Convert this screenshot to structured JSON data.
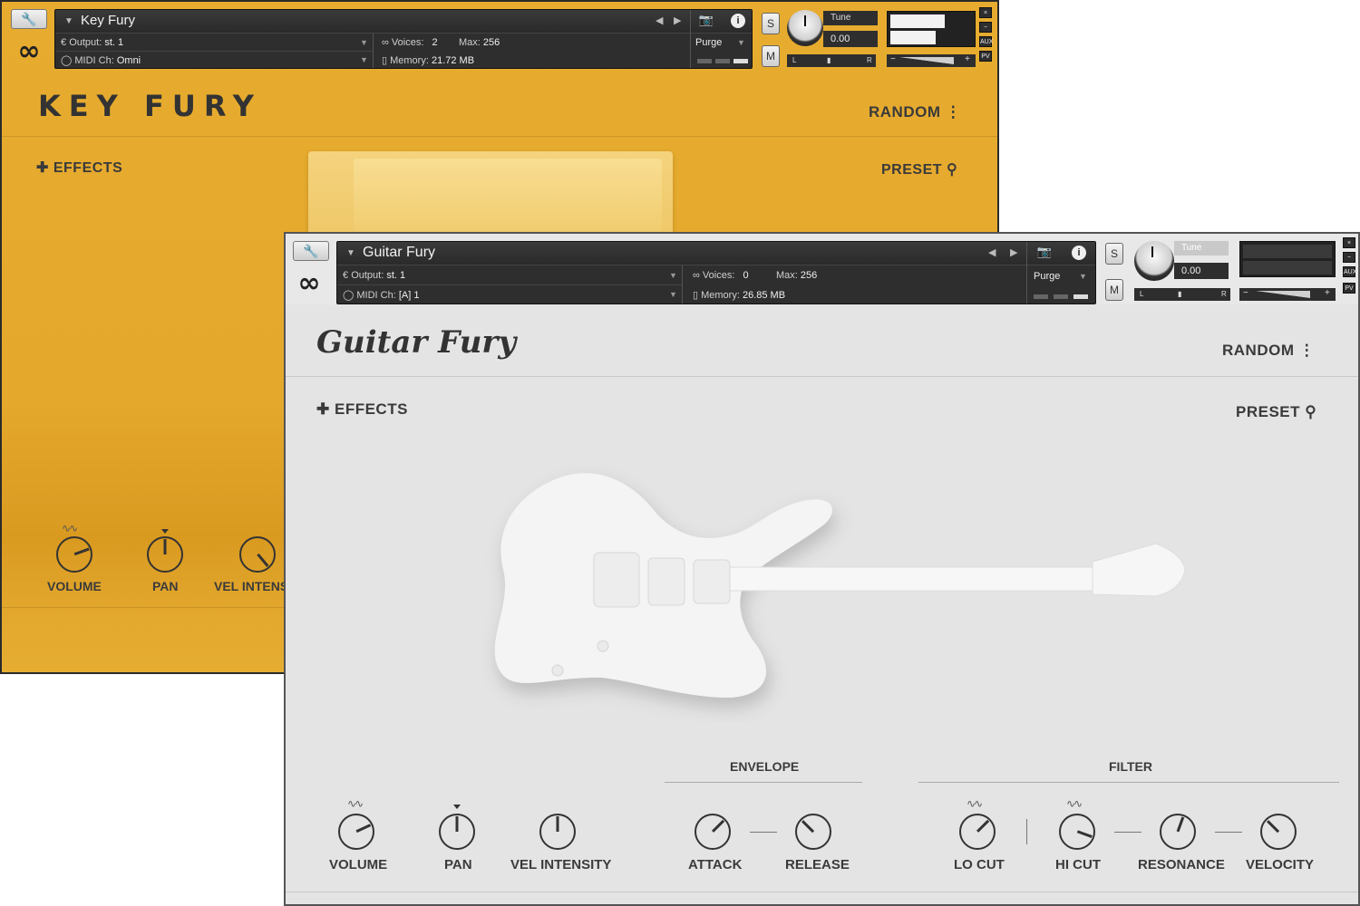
{
  "key_fury": {
    "panel": {
      "instrument_name": "Key Fury",
      "output_label": "Output:",
      "output_value": "st. 1",
      "midi_label": "MIDI Ch:",
      "midi_value": "Omni",
      "voices_label": "Voices:",
      "voices_value": "2",
      "max_label": "Max:",
      "max_value": "256",
      "memory_label": "Memory:",
      "memory_value": "21.72 MB",
      "purge_label": "Purge",
      "solo_label": "S",
      "mute_label": "M",
      "tune_label": "Tune",
      "tune_value": "0.00",
      "pan_left": "L",
      "pan_right": "R"
    },
    "title": "KEY FURY",
    "nav": {
      "random_label": "RANDOM",
      "preset_label": "PRESET",
      "effects_label": "EFFECTS"
    },
    "knobs": [
      "VOLUME",
      "PAN",
      "VEL INTENSIT"
    ]
  },
  "guitar_fury": {
    "panel": {
      "instrument_name": "Guitar Fury",
      "output_label": "Output:",
      "output_value": "st. 1",
      "midi_label": "MIDI Ch:",
      "midi_value": "[A]  1",
      "voices_label": "Voices:",
      "voices_value": "0",
      "max_label": "Max:",
      "max_value": "256",
      "memory_label": "Memory:",
      "memory_value": "26.85 MB",
      "purge_label": "Purge",
      "solo_label": "S",
      "mute_label": "M",
      "tune_label": "Tune",
      "tune_value": "0.00",
      "pan_left": "L",
      "pan_right": "R"
    },
    "title": "Guitar Fury",
    "nav": {
      "random_label": "RANDOM",
      "preset_label": "PRESET",
      "effects_label": "EFFECTS"
    },
    "sections": {
      "envelope": "ENVELOPE",
      "filter": "FILTER"
    },
    "knobs": [
      "VOLUME",
      "PAN",
      "VEL INTENSITY",
      "ATTACK",
      "RELEASE",
      "LO CUT",
      "HI CUT",
      "RESONANCE",
      "VELOCITY"
    ]
  },
  "side_buttons": {
    "close": "×",
    "minimize": "−",
    "aux": "AUX",
    "pv": "PV"
  },
  "volume_minus": "−",
  "volume_plus": "+",
  "colors": {
    "key_fury_bg": "#e6aa30",
    "guitar_fury_bg": "#e4e4e4",
    "panel_bg": "#2e2e2e"
  }
}
